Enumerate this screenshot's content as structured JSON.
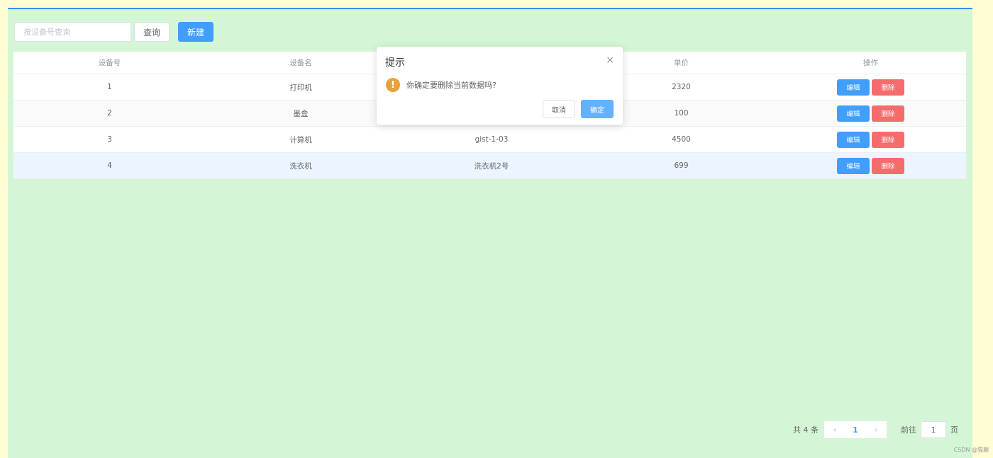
{
  "toolbar": {
    "search_placeholder": "按设备号查询",
    "query_label": "查询",
    "new_label": "新建"
  },
  "table": {
    "headers": [
      "设备号",
      "设备名",
      "",
      "单价",
      "操作"
    ],
    "rows": [
      {
        "id": "1",
        "name": "打印机",
        "code": "",
        "price": "2320"
      },
      {
        "id": "2",
        "name": "墨盒",
        "code": "",
        "price": "100"
      },
      {
        "id": "3",
        "name": "计算机",
        "code": "gist-1-03",
        "price": "4500"
      },
      {
        "id": "4",
        "name": "洗衣机",
        "code": "洗衣机2号",
        "price": "699"
      }
    ],
    "edit_label": "编辑",
    "delete_label": "删除"
  },
  "pagination": {
    "total": "共 4 条",
    "prev": "‹",
    "current": "1",
    "next": "›",
    "goto": "前往",
    "goto_value": "1",
    "unit": "页"
  },
  "dialog": {
    "title": "提示",
    "close": "×",
    "icon": "!",
    "message": "你确定要删除当前数据吗?",
    "cancel_label": "取消",
    "confirm_label": "确定"
  },
  "watermark": "CSDN @猫巅",
  "colors": {
    "primary": "#409eff",
    "danger": "#f56c6c",
    "warning": "#e6a23c",
    "panel_bg": "#d4f6d6",
    "page_bg": "#fffdd3"
  }
}
